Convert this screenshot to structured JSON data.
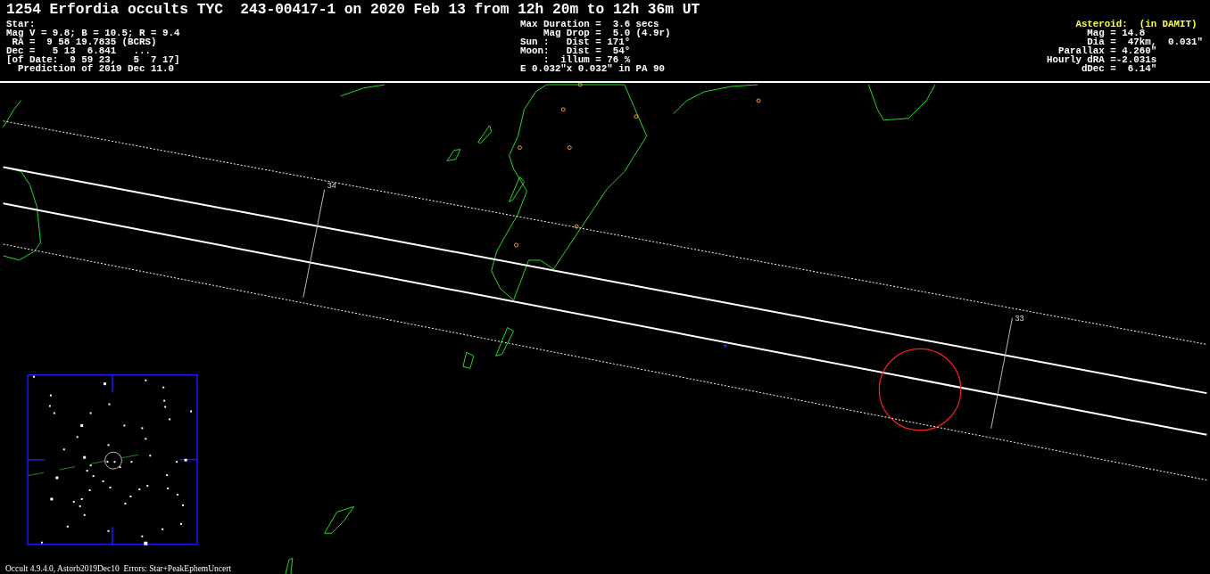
{
  "title": "1254 Erfordia occults TYC  243-00417-1 on 2020 Feb 13 from 12h 20m to 12h 36m UT",
  "star_info": {
    "lines": [
      "Star:",
      "Mag V = 9.8; B = 10.5; R = 9.4",
      " RA =  9 58 19.7835 (BCRS)",
      "Dec =   5 13  6.841   ...",
      "[of Date:  9 59 23,   5  7 17]",
      "  Prediction of 2019 Dec 11.0"
    ]
  },
  "event_info": {
    "lines": [
      "Max Duration =  3.6 secs",
      "    Mag Drop =  5.0 (4.9r)",
      "Sun :   Dist = 171°",
      "Moon:   Dist =  54°",
      "    :  illum = 76 %",
      "E 0.032\"x 0.032\" in PA 90"
    ]
  },
  "asteroid_info": {
    "heading": "     Asteroid:  (in DAMIT)",
    "lines": [
      "       Mag = 14.8",
      "       Dia =  47km,  0.031\"",
      "  Parallax = 4.260\"",
      "Hourly dRA =-2.031s",
      "      dDec =  6.14\""
    ]
  },
  "map": {
    "time_labels": [
      "34",
      "33"
    ]
  },
  "footer": "Occult 4.9.4.0, Astorb2019Dec10  Errors: Star+PeakEphemUncert"
}
